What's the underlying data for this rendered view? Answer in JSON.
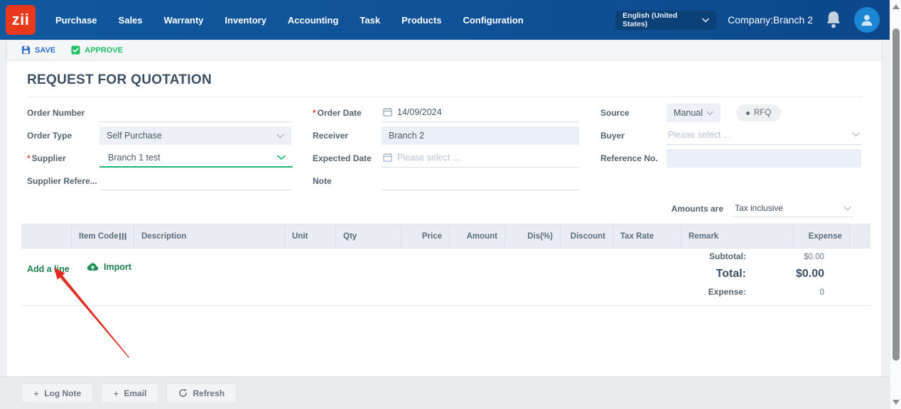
{
  "nav": {
    "logo": "zii",
    "items": [
      "Purchase",
      "Sales",
      "Warranty",
      "Inventory",
      "Accounting",
      "Task",
      "Products",
      "Configuration"
    ],
    "language": "English (United States)",
    "company": "Company:Branch 2"
  },
  "toolbar": {
    "save": "SAVE",
    "approve": "APPROVE"
  },
  "page": {
    "title": "REQUEST FOR QUOTATION"
  },
  "form": {
    "required_marker": "*",
    "order_number_label": "Order Number",
    "order_type_label": "Order Type",
    "order_type_value": "Self Purchase",
    "supplier_label": "Supplier",
    "supplier_value": "Branch 1 test",
    "supplier_ref_label": "Supplier Refere...",
    "order_date_label": "Order Date",
    "order_date_value": "14/09/2024",
    "receiver_label": "Receiver",
    "receiver_value": "Branch 2",
    "expected_date_label": "Expected Date",
    "expected_date_placeholder": "Please select ...",
    "note_label": "Note",
    "source_label": "Source",
    "source_value": "Manual",
    "source_badge": "RFQ",
    "buyer_label": "Buyer",
    "buyer_placeholder": "Please select ...",
    "reference_label": "Reference No."
  },
  "amounts": {
    "label": "Amounts are",
    "value": "Tax inclusive"
  },
  "table": {
    "headers": [
      "Item Code",
      "Description",
      "Unit",
      "Qty",
      "Price",
      "Amount",
      "Dis(%)",
      "Discount",
      "Tax Rate",
      "Remark",
      "Expense"
    ]
  },
  "lines": {
    "add_line": "Add a line",
    "import": "Import"
  },
  "totals": {
    "subtotal_label": "Subtotal:",
    "subtotal_value": "$0.00",
    "total_label": "Total:",
    "total_value": "$0.00",
    "expense_label": "Expense:",
    "expense_value": "0"
  },
  "footer": {
    "plus": "+",
    "log_note": "Log Note",
    "email": "Email",
    "refresh": "Refresh"
  },
  "colors": {
    "nav_blue": "#0f5196",
    "logo_red": "#e8391d",
    "accent_green": "#21b573",
    "link_green": "#1e7e4f",
    "save_blue": "#2e6fd0",
    "approve_green": "#21c065"
  }
}
